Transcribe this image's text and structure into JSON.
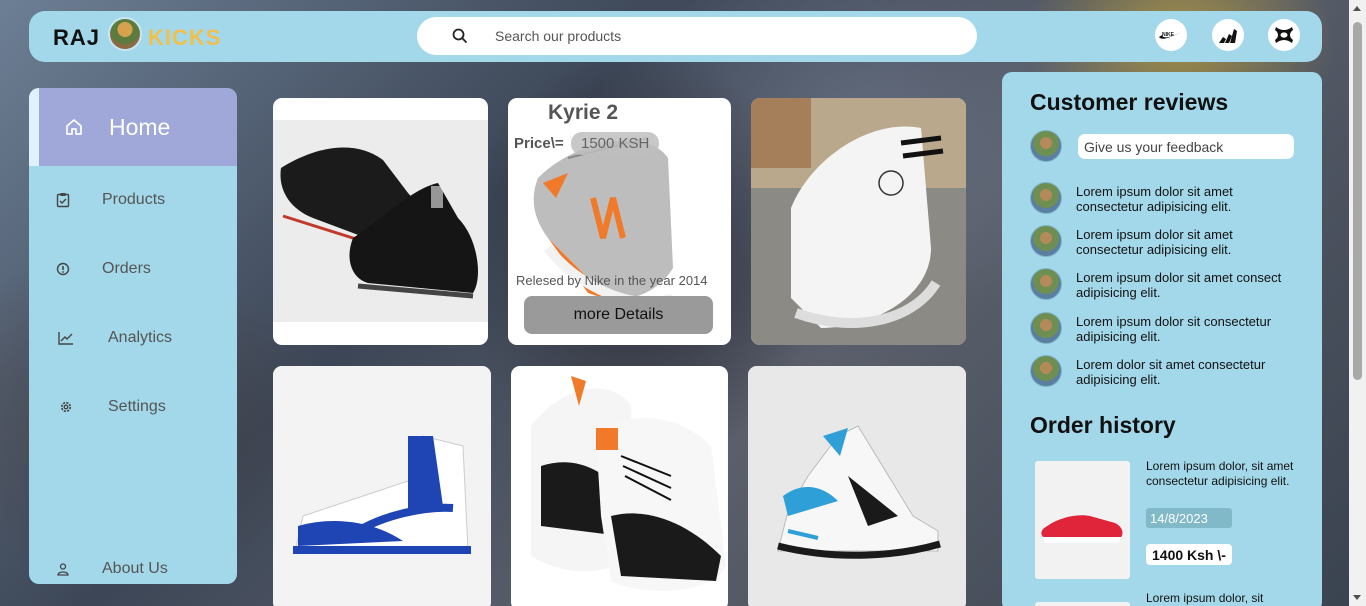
{
  "header": {
    "logo_left": "RAJ",
    "logo_right": "KICKS",
    "search_placeholder": "Search our products",
    "brands": [
      "nike-logo-icon",
      "adidas-logo-icon",
      "under-armour-logo-icon"
    ]
  },
  "sidebar": {
    "items": [
      {
        "label": "Home",
        "icon": "home-icon"
      },
      {
        "label": "Products",
        "icon": "clipboard-icon"
      },
      {
        "label": "Orders",
        "icon": "alert-circle-icon"
      },
      {
        "label": "Analytics",
        "icon": "chart-line-icon"
      },
      {
        "label": "Settings",
        "icon": "gear-icon"
      },
      {
        "label": "About Us",
        "icon": "user-icon"
      }
    ]
  },
  "products": {
    "featured": {
      "name": "Kyrie 2",
      "price_label": "Price\\=",
      "price": "1500 KSH",
      "note": "Relesed by Nike in the year 2014",
      "button": "more Details"
    }
  },
  "reviews": {
    "title": "Customer reviews",
    "feedback_placeholder": "Give us your feedback",
    "items": [
      "Lorem ipsum dolor sit amet consectetur adipisicing elit.",
      "Lorem ipsum dolor sit amet consectetur adipisicing elit.",
      "Lorem ipsum dolor sit amet consect adipisicing elit.",
      "Lorem ipsum dolor sit consectetur adipisicing elit.",
      "Lorem dolor sit amet consectetur adipisicing elit."
    ]
  },
  "orders": {
    "title": "Order history",
    "items": [
      {
        "text": "Lorem ipsum dolor, sit amet consectetur adipisicing elit.",
        "date": "14/8/2023",
        "price": "1400 Ksh \\-"
      },
      {
        "text": "Lorem ipsum dolor, sit"
      }
    ]
  },
  "colors": {
    "panel": "#a3d8ea",
    "active_nav": "#9fa8d8",
    "logo_accent": "#f2c04a"
  }
}
